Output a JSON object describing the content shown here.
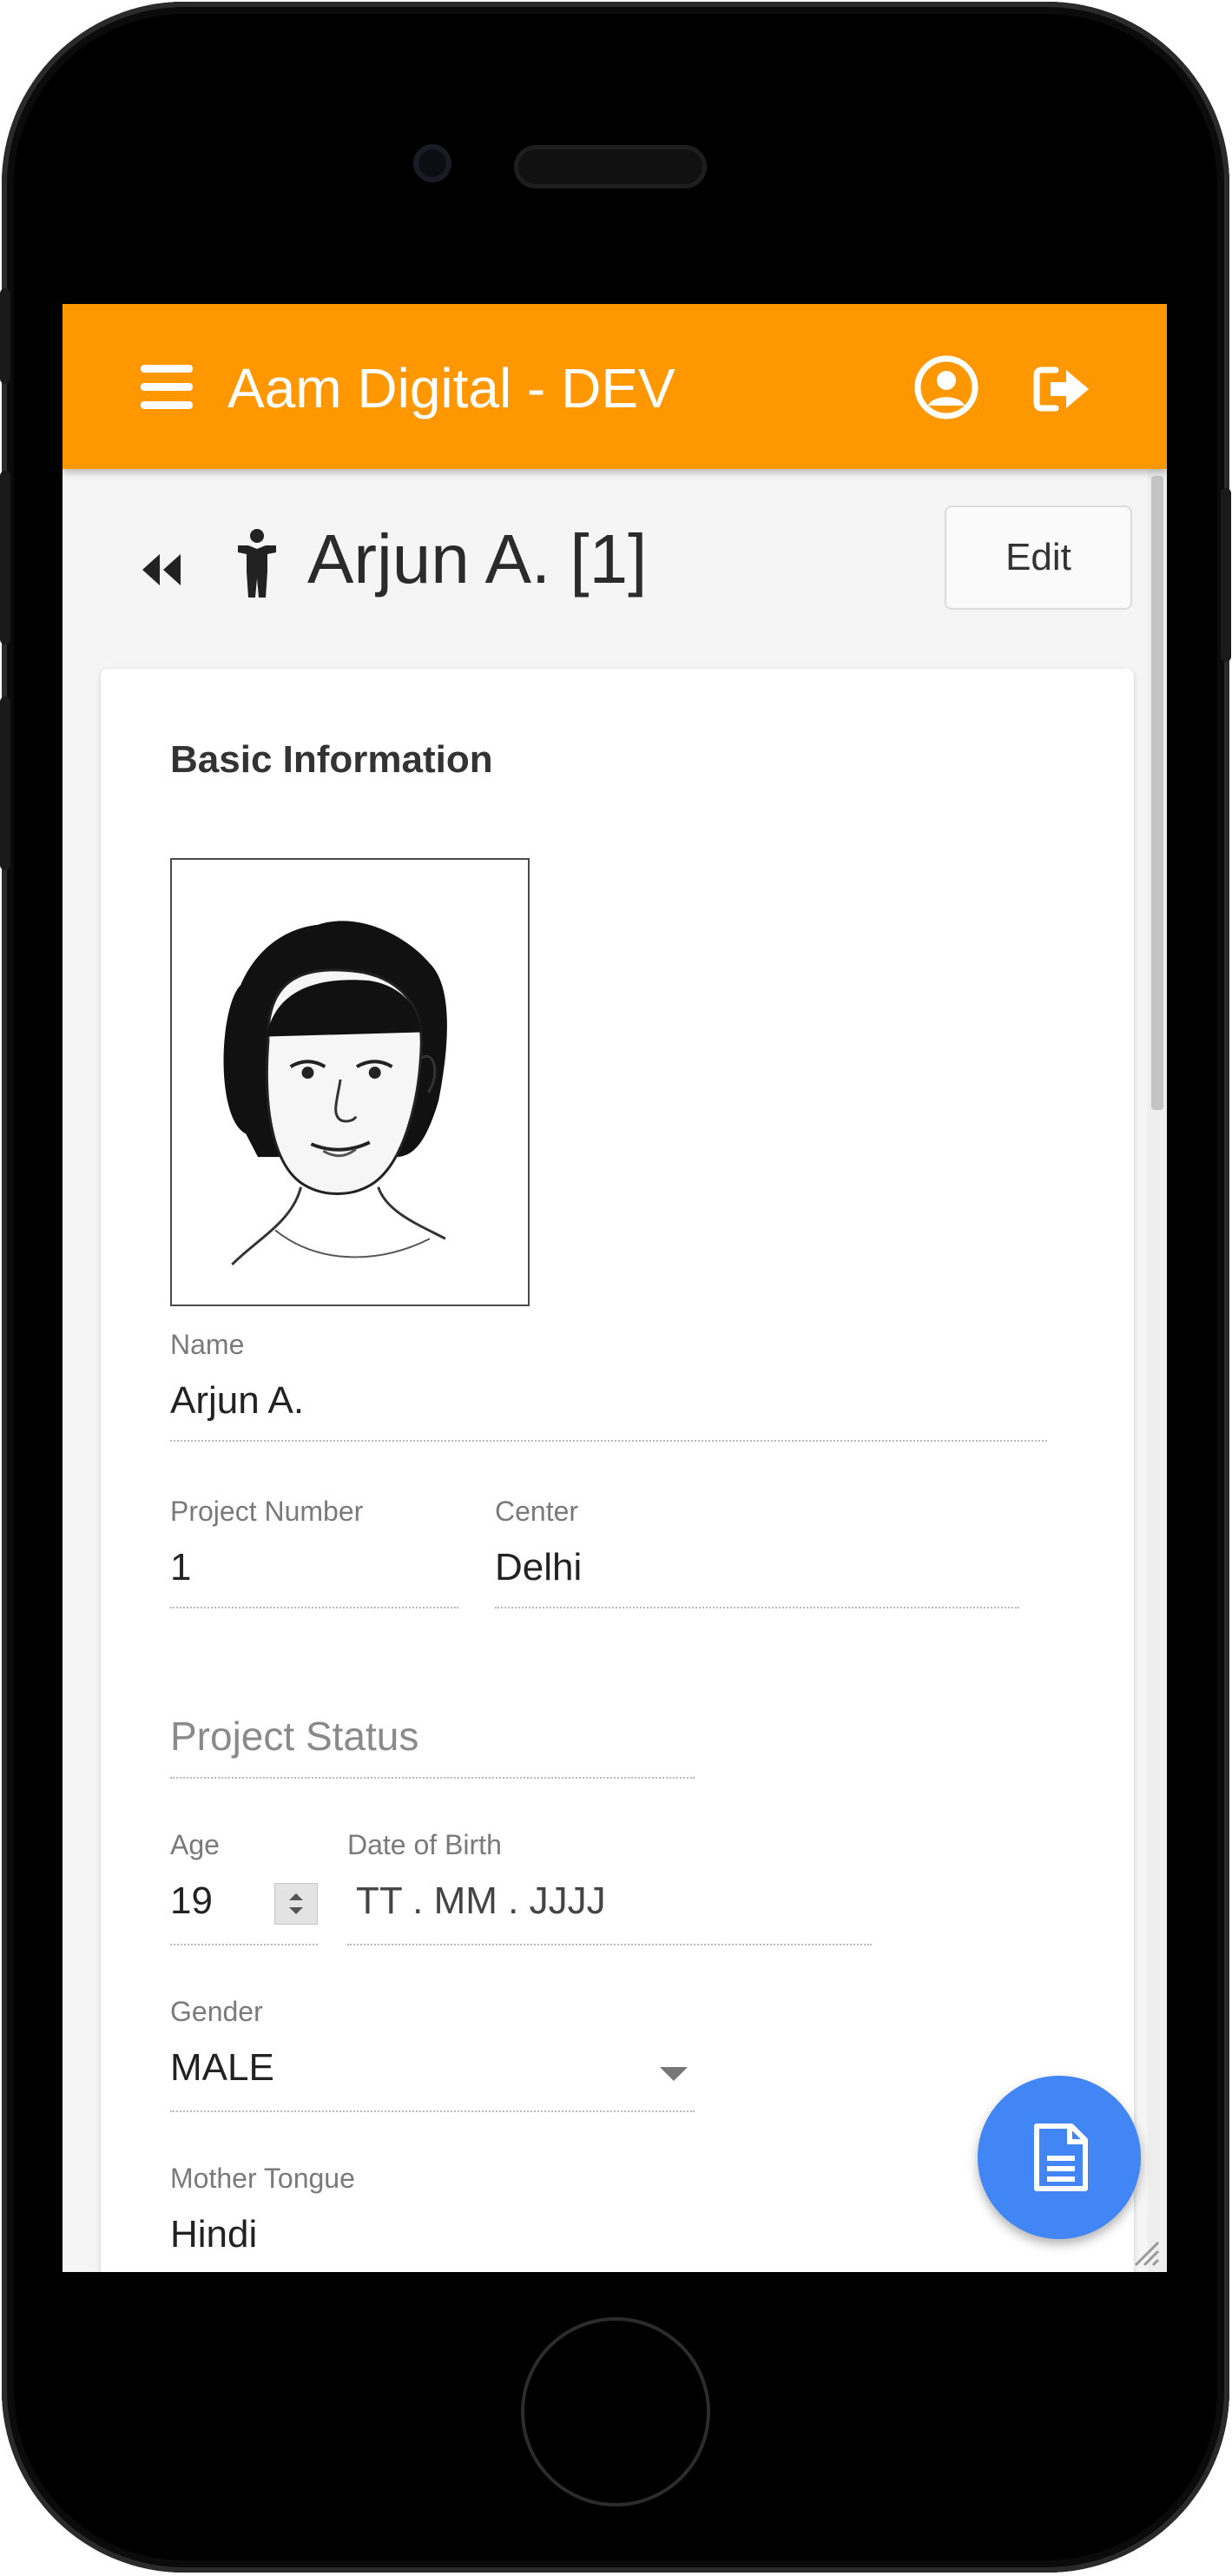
{
  "app": {
    "title": "Aam Digital - DEV"
  },
  "header": {
    "menu_icon": "menu-icon",
    "account_icon": "account-circle-icon",
    "logout_icon": "logout-icon"
  },
  "page": {
    "title": "Arjun A. [1]",
    "back_icon": "double-chevron-left-icon",
    "entity_icon": "child-icon",
    "edit_label": "Edit"
  },
  "section": {
    "title": "Basic Information"
  },
  "fields": {
    "name": {
      "label": "Name",
      "value": "Arjun A."
    },
    "project_number": {
      "label": "Project Number",
      "value": "1"
    },
    "center": {
      "label": "Center",
      "value": "Delhi"
    },
    "project_status": {
      "placeholder": "Project Status",
      "value": ""
    },
    "age": {
      "label": "Age",
      "value": "19"
    },
    "dob": {
      "label": "Date of Birth",
      "placeholder": "TT . MM . JJJJ"
    },
    "gender": {
      "label": "Gender",
      "value": "MALE"
    },
    "mother_tongue": {
      "label": "Mother Tongue",
      "value": "Hindi"
    }
  },
  "fab": {
    "icon": "document-icon"
  },
  "colors": {
    "toolbar": "#ff9800",
    "fab": "#4285f4",
    "background": "#f5f5f5"
  }
}
